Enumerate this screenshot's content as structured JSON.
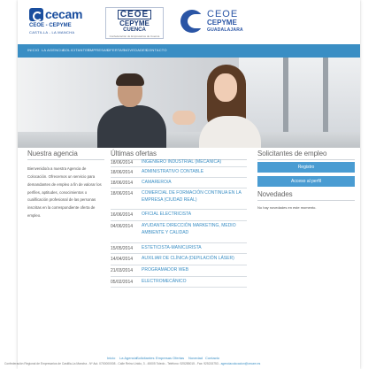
{
  "logos": {
    "cecam": {
      "name": "cecam",
      "sub1": "CEOE - CEPYME",
      "sub2": "CASTILLA - LA MANCHA"
    },
    "ceoe_cuenca": {
      "line1": "CEOE",
      "line2": "CEPYME",
      "line3": "CUENCA",
      "line4": "Confederación de Empresarios de Cuenca"
    },
    "ceoe_guadalajara": {
      "line1": "CEOE",
      "line2": "CEPYME",
      "line3": "GUADALAJARA"
    }
  },
  "nav": [
    "INICIO",
    "LA AGENCIA",
    "SOLICITANTES",
    "EMPRESAS",
    "OFERTAS",
    "NOVEDADES",
    "CONTACTO"
  ],
  "agency": {
    "title": "Nuestra agencia",
    "paragraph": "Bienvenido/a a nuestra Agencia de Colocación. Ofrecemos un servicio para demandantes de empleo a fin de valorar los perfiles, aptitudes, conocimientos o cualificación profesional de las personas inscritas en la correspondiente oferta de empleo."
  },
  "offers": {
    "title": "Últimas ofertas",
    "items": [
      {
        "date": "18/06/2014",
        "title": "INGENIERO INDUSTRIAL (MECANICA)"
      },
      {
        "date": "18/06/2014",
        "title": "ADMINISTRATIVO CONTABLE"
      },
      {
        "date": "18/06/2014",
        "title": "CAMARERO/A"
      },
      {
        "date": "18/06/2014",
        "title": "COMERCIAL DE FORMACIÓN CONTINUA EN LA EMPRESA (CIUDAD REAL)"
      },
      {
        "date": "16/06/2014",
        "title": "OFICIAL ELECTRICISTA"
      },
      {
        "date": "04/06/2014",
        "title": "AYUDANTE DIRECCIÓN MARKETING, MEDIO AMBIENTE Y CALIDAD"
      },
      {
        "date": "15/05/2014",
        "title": "ESTETICISTA-MANICURISTA"
      },
      {
        "date": "14/04/2014",
        "title": "AUXILIAR DE CLÍNICA (DEPILACIÓN LÁSER)"
      },
      {
        "date": "21/03/2014",
        "title": "PROGRAMADOR WEB"
      },
      {
        "date": "05/02/2014",
        "title": "ELECTROMECÁNICO"
      }
    ]
  },
  "applicants": {
    "title": "Solicitantes de empleo",
    "register_button": "Registro",
    "profile_button": "Acceso al perfil"
  },
  "news": {
    "title": "Novedades",
    "empty_text": "No hay novedades en este momento."
  },
  "footer": {
    "links": [
      "Inicio",
      "La Agencia",
      "Solicitantes",
      "Empresas",
      "Ofertas",
      "Novedad",
      "Contacto"
    ],
    "address": "Confederación Regional de Empresarios de Castilla-La Mancha - Nº Aut. 0700000008 - Calle Reino Unido, 3 - 45005 Toledo - Teléfono: 925285015 - Fax: 925215753 - ",
    "email": "agenciacolocacion@cecam.es"
  },
  "colors": {
    "nav": "#3a8ec4",
    "button": "#4a9cd2",
    "link": "#3a8ec4",
    "brand": "#1a4e9e"
  }
}
